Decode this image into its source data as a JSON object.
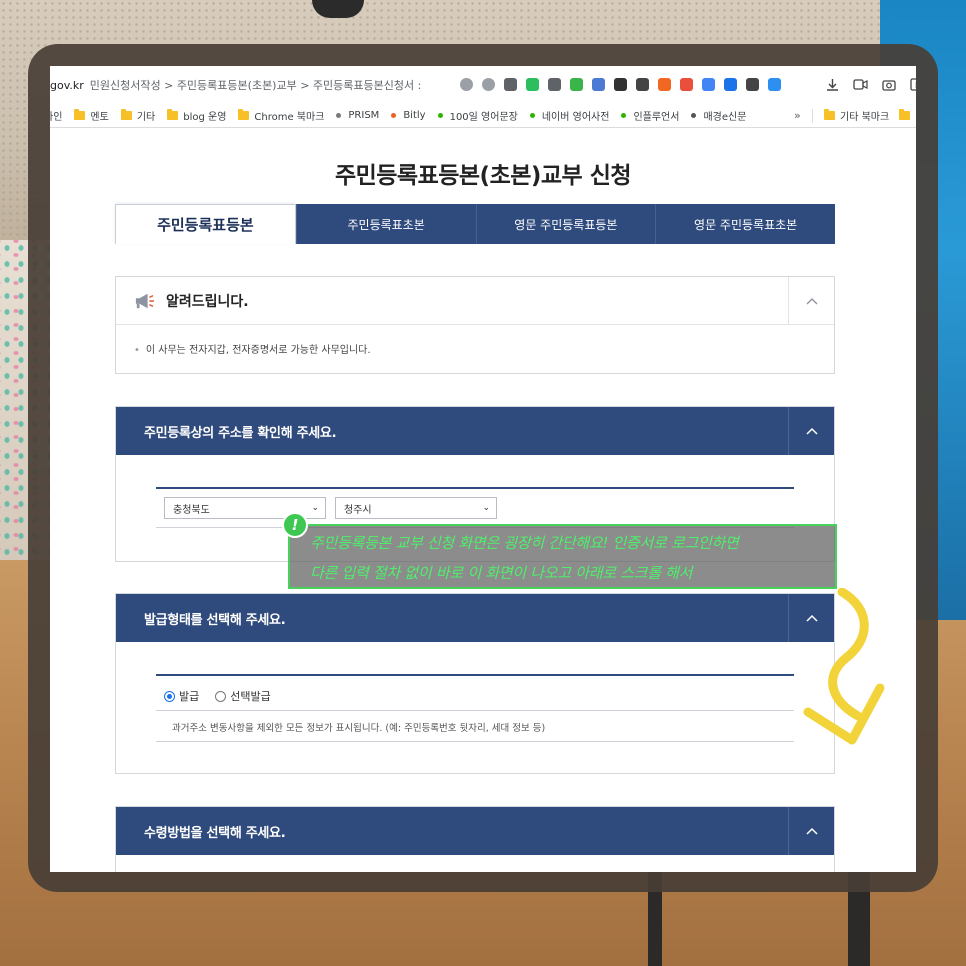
{
  "browser": {
    "domain": "gov.kr",
    "breadcrumb": "민원신청서작성 > 주민등록표등본(초본)교부 > 주민등록표등본신청서 :",
    "extensions": [
      {
        "name": "shield-icon",
        "color": "#9aa0a6"
      },
      {
        "name": "star-icon",
        "color": "#9aa0a6"
      },
      {
        "name": "pocket-icon",
        "color": "#5f6368"
      },
      {
        "name": "evernote-icon",
        "color": "#2dbe60"
      },
      {
        "name": "extension-icon",
        "color": "#5f6368"
      },
      {
        "name": "onenote-icon",
        "color": "#3bb54a"
      },
      {
        "name": "new-icon",
        "color": "#4a7ad4"
      },
      {
        "name": "pen-icon",
        "color": "#333333"
      },
      {
        "name": "box-icon",
        "color": "#444444"
      },
      {
        "name": "orange-icon",
        "color": "#f26722"
      },
      {
        "name": "circle-icon",
        "color": "#e94f3a"
      },
      {
        "name": "translate-icon",
        "color": "#4285f4"
      },
      {
        "name": "google-translate-icon",
        "color": "#1a73e8"
      },
      {
        "name": "media-icon",
        "color": "#444444"
      },
      {
        "name": "blue-icon",
        "color": "#2d8ff0"
      }
    ],
    "right_icons": [
      "download-icon",
      "record-icon",
      "camera-icon",
      "info-icon"
    ]
  },
  "bookmarks": {
    "items": [
      {
        "type": "folder",
        "label": "화인"
      },
      {
        "type": "folder",
        "label": "멘토"
      },
      {
        "type": "folder",
        "label": "기타"
      },
      {
        "type": "folder",
        "label": "blog 운영"
      },
      {
        "type": "folder",
        "label": "Chrome 북마크"
      },
      {
        "type": "dot",
        "label": "PRISM",
        "color": "#7a7a7a"
      },
      {
        "type": "dot",
        "label": "Bitly",
        "color": "#ee6123"
      },
      {
        "type": "dot",
        "label": "100일 영어문장",
        "color": "#2db400"
      },
      {
        "type": "dot",
        "label": "네이버 영어사전",
        "color": "#2db400"
      },
      {
        "type": "dot",
        "label": "인플루언서",
        "color": "#2db400"
      },
      {
        "type": "dot",
        "label": "매경e신문",
        "color": "#555555"
      }
    ],
    "more": "»",
    "right_folder": "기타 북마크"
  },
  "page": {
    "title": "주민등록표등본(초본)교부 신청",
    "tabs": [
      {
        "label": "주민등록표등본",
        "active": true
      },
      {
        "label": "주민등록표초본",
        "active": false
      },
      {
        "label": "영문 주민등록표등본",
        "active": false
      },
      {
        "label": "영문 주민등록표초본",
        "active": false
      }
    ],
    "notice": {
      "title": "알려드립니다.",
      "body": "이 사무는 전자지갑, 전자증명서로 가능한 사무입니다."
    },
    "address_section": {
      "title": "주민등록상의 주소를 확인해 주세요.",
      "province": "충청북도",
      "city": "청주시"
    },
    "issue_section": {
      "title": "발급형태를 선택해 주세요.",
      "option_issue": "발급",
      "option_select": "선택발급",
      "selected": "발급",
      "description": "과거주소 변동사항을 제외한 모든 정보가 표시됩니다. (예: 주민등록번호 뒷자리, 세대 정보 등)"
    },
    "receive_section": {
      "title": "수령방법을 선택해 주세요."
    }
  },
  "annotation": {
    "badge": "!",
    "line1": "주민등록등본 교부 신청 화면은 굉장히 간단해요! 인증서로 로그인하면",
    "line2": "다른 입력 절차 없이 바로 이 화면이 나오고 아래로 스크롤 해서",
    "color": "#4ef06a"
  },
  "colors": {
    "primary": "#2f4a7c",
    "frame": "#483e36"
  }
}
